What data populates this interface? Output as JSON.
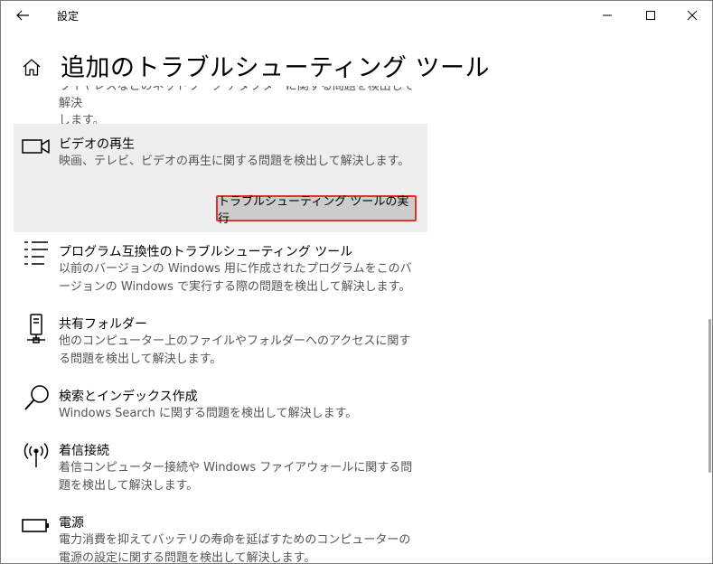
{
  "window": {
    "title": "設定"
  },
  "header": {
    "title": "追加のトラブルシューティング ツール"
  },
  "partial_item": {
    "desc_line1": "ワイヤレスなどのネットワーク アダプターに関する問題を検出して解決",
    "desc_line2": "します。"
  },
  "items": [
    {
      "title": "ビデオの再生",
      "desc": "映画、テレビ、ビデオの再生に関する問題を検出して解決します。",
      "button": "トラブルシューティング ツールの実行",
      "icon": "video-camera-icon"
    },
    {
      "title": "プログラム互換性のトラブルシューティング ツール",
      "desc": "以前のバージョンの Windows 用に作成されたプログラムをこのバージョンの Windows で実行する際の問題を検出して解決します。",
      "icon": "list-icon"
    },
    {
      "title": "共有フォルダー",
      "desc": "他のコンピューター上のファイルやフォルダーへのアクセスに関する問題を検出して解決します。",
      "icon": "network-drive-icon"
    },
    {
      "title": "検索とインデックス作成",
      "desc": "Windows Search に関する問題を検出して解決します。",
      "icon": "search-icon"
    },
    {
      "title": "着信接続",
      "desc": "着信コンピューター接続や Windows ファイアウォールに関する問題を検出して解決します。",
      "icon": "antenna-icon"
    },
    {
      "title": "電源",
      "desc": "電力消費を抑えてバッテリの寿命を延ばすためのコンピューターの電源の設定に関する問題を検出して解決します。",
      "icon": "battery-icon"
    }
  ],
  "colors": {
    "selected_bg": "#eeeeee",
    "button_bg": "#cccccc",
    "highlight_border": "#e0322c"
  }
}
